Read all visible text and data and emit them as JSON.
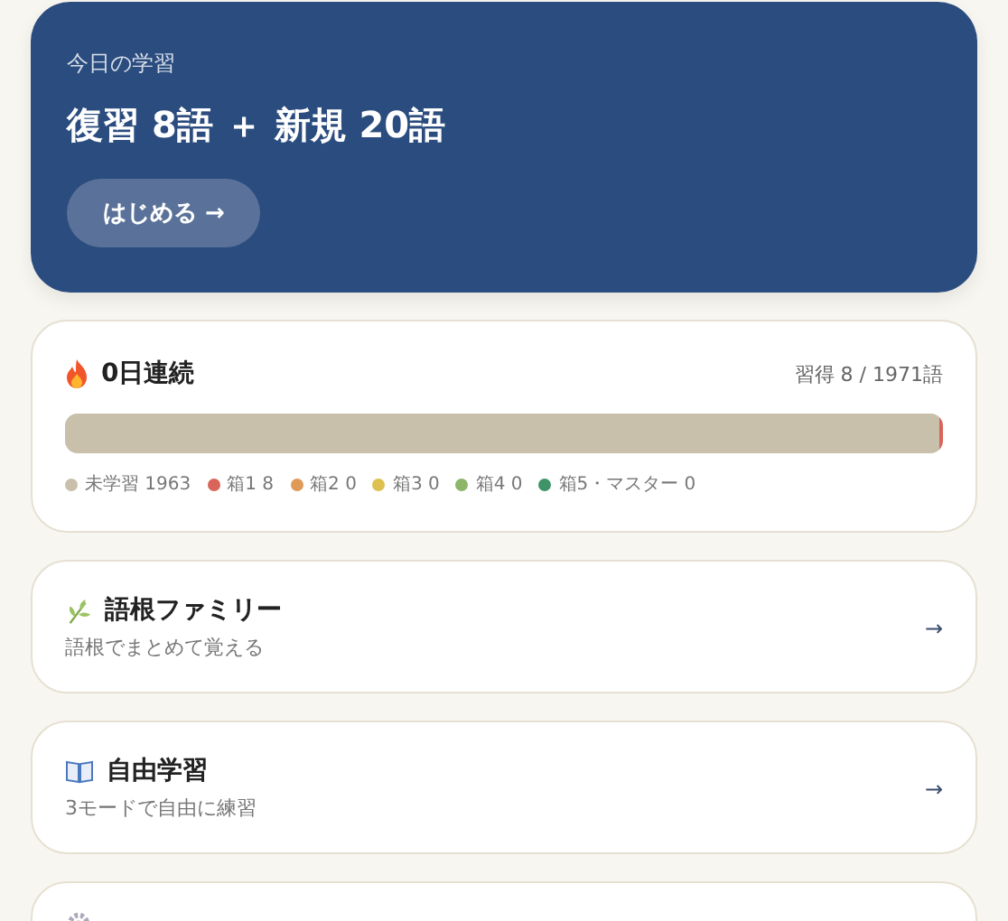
{
  "hero": {
    "caption": "今日の学習",
    "headline": "復習 8語 ＋ 新規 20語",
    "button": "はじめる →"
  },
  "streak": {
    "title": "0日連続",
    "learned": "習得 8 / 1971語",
    "segments": [
      {
        "level": 0.9959,
        "color": "#c8c0ab"
      },
      {
        "level": 0.0041,
        "color": "#d9655a"
      }
    ],
    "legend": [
      {
        "label": "未学習 1963",
        "color": "#c8c0ab"
      },
      {
        "label": "箱1 8",
        "color": "#d9655a"
      },
      {
        "label": "箱2 0",
        "color": "#e09a58"
      },
      {
        "label": "箱3 0",
        "color": "#dcc050"
      },
      {
        "label": "箱4 0",
        "color": "#8db668"
      },
      {
        "label": "箱5・マスター 0",
        "color": "#3f9467"
      }
    ]
  },
  "menu": [
    {
      "kind": "sprout",
      "title": "語根ファミリー",
      "subtitle": "語根でまとめて覚える",
      "arrow": "→"
    },
    {
      "kind": "book",
      "title": "自由学習",
      "subtitle": "3モードで自由に練習",
      "arrow": "→"
    },
    {
      "kind": "gear"
    }
  ]
}
